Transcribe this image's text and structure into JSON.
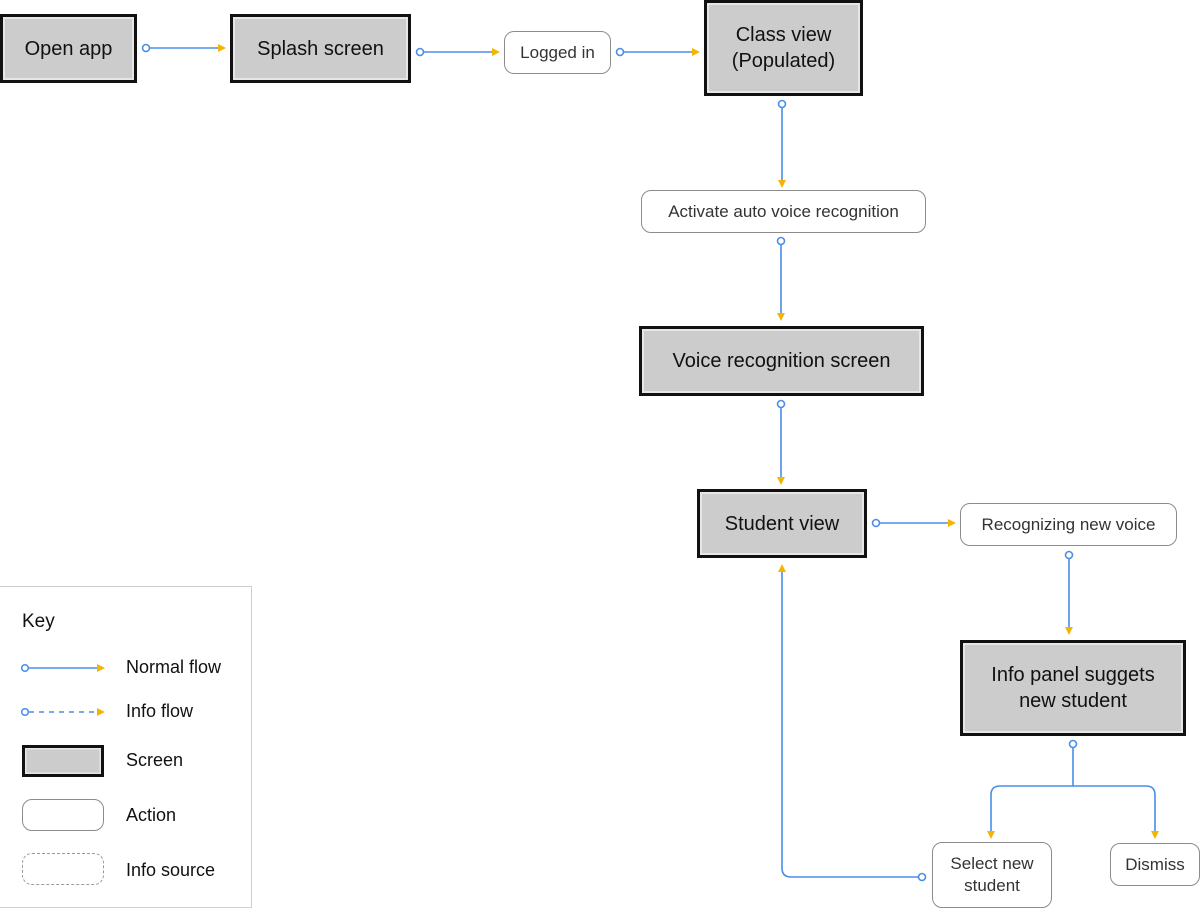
{
  "colors": {
    "flow_line": "#4a8ee8",
    "arrowhead": "#f5b400",
    "screen_fill": "#cccccc",
    "screen_border": "#111111",
    "action_border": "#8c8c8c"
  },
  "nodes": {
    "open_app": {
      "label": "Open app",
      "type": "screen"
    },
    "splash_screen": {
      "label": "Splash screen",
      "type": "screen"
    },
    "logged_in": {
      "label": "Logged in",
      "type": "action"
    },
    "class_view": {
      "label": "Class view\n(Populated)",
      "line1": "Class view",
      "line2": "(Populated)",
      "type": "screen"
    },
    "activate_voice": {
      "label": "Activate auto voice recognition",
      "type": "action"
    },
    "voice_recognition_screen": {
      "label": "Voice recognition screen",
      "type": "screen"
    },
    "student_view": {
      "label": "Student view",
      "type": "screen"
    },
    "recognizing_new_voice": {
      "label": "Recognizing new voice",
      "type": "action"
    },
    "info_panel": {
      "line1": "Info panel suggets",
      "line2": "new student",
      "type": "screen"
    },
    "select_new_student": {
      "line1": "Select new",
      "line2": "student",
      "type": "action"
    },
    "dismiss": {
      "label": "Dismiss",
      "type": "action"
    }
  },
  "edges": [
    {
      "from": "open_app",
      "to": "splash_screen",
      "kind": "normal"
    },
    {
      "from": "splash_screen",
      "to": "logged_in",
      "kind": "normal"
    },
    {
      "from": "logged_in",
      "to": "class_view",
      "kind": "normal"
    },
    {
      "from": "class_view",
      "to": "activate_voice",
      "kind": "normal"
    },
    {
      "from": "activate_voice",
      "to": "voice_recognition_screen",
      "kind": "normal"
    },
    {
      "from": "voice_recognition_screen",
      "to": "student_view",
      "kind": "normal"
    },
    {
      "from": "student_view",
      "to": "recognizing_new_voice",
      "kind": "normal"
    },
    {
      "from": "recognizing_new_voice",
      "to": "info_panel",
      "kind": "normal"
    },
    {
      "from": "info_panel",
      "to": "select_new_student",
      "kind": "normal"
    },
    {
      "from": "info_panel",
      "to": "dismiss",
      "kind": "normal"
    },
    {
      "from": "select_new_student",
      "to": "student_view",
      "kind": "normal"
    }
  ],
  "key": {
    "title": "Key",
    "items": [
      {
        "label": "Normal flow"
      },
      {
        "label": "Info flow"
      },
      {
        "label": "Screen"
      },
      {
        "label": "Action"
      },
      {
        "label": "Info source"
      }
    ]
  }
}
